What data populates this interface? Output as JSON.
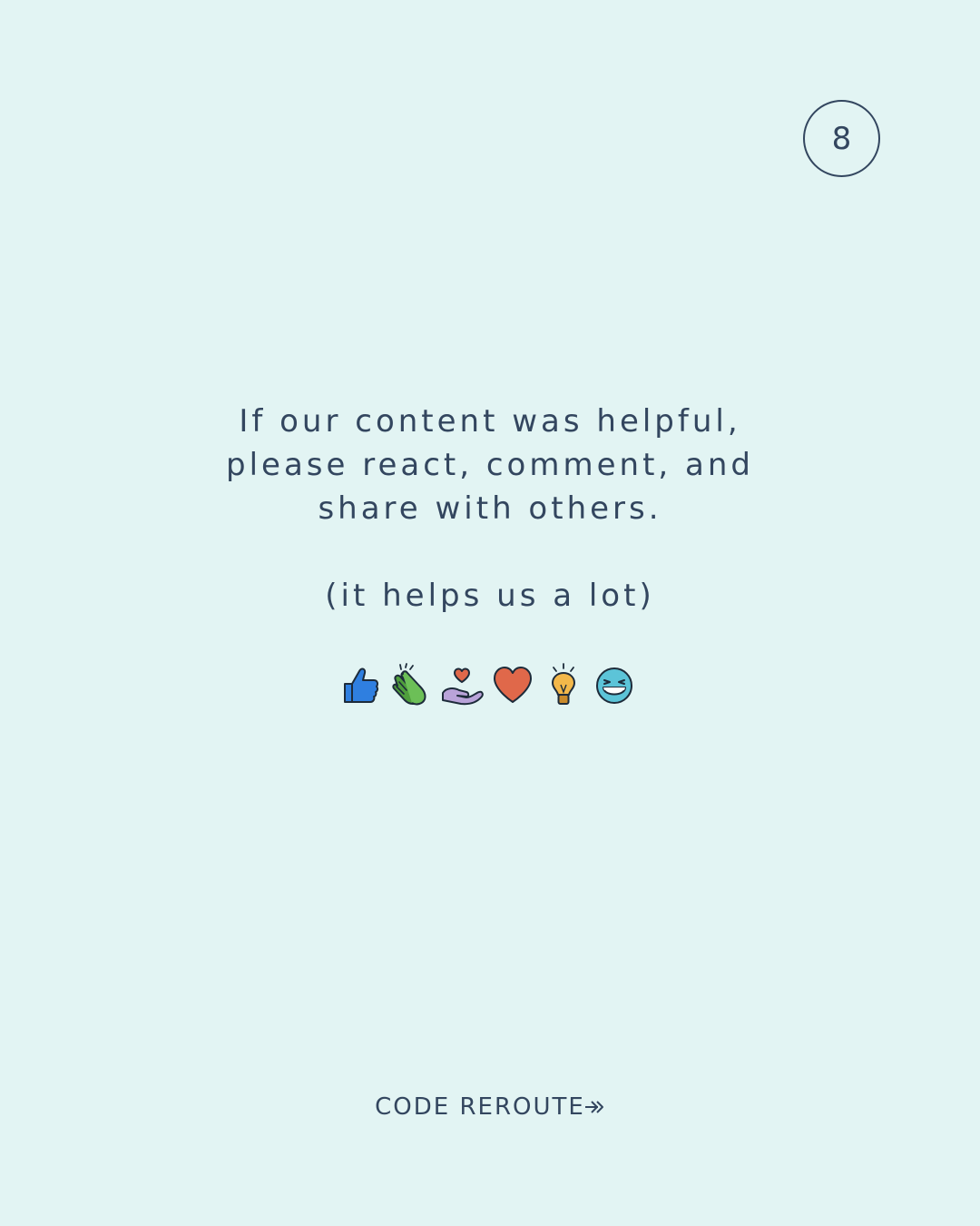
{
  "page_number": "8",
  "message": {
    "lines": [
      "If our content was helpful,",
      "please react, comment, and",
      "share with others."
    ],
    "subtext": "(it helps us a lot)"
  },
  "reactions": [
    {
      "icon": "thumbs-up-icon",
      "color": "#2f7fe0"
    },
    {
      "icon": "clapping-hands-icon",
      "color": "#5fae4b"
    },
    {
      "icon": "heart-in-hand-icon",
      "color": "#b9a3d9"
    },
    {
      "icon": "heart-icon",
      "color": "#e0684a"
    },
    {
      "icon": "lightbulb-icon",
      "color": "#f3b84a"
    },
    {
      "icon": "laughing-face-icon",
      "color": "#5cc4d8"
    }
  ],
  "brand": {
    "name": "CODE REROUTE",
    "icon": "double-arrow-icon"
  },
  "colors": {
    "background": "#e2f4f3",
    "text": "#33465f"
  }
}
